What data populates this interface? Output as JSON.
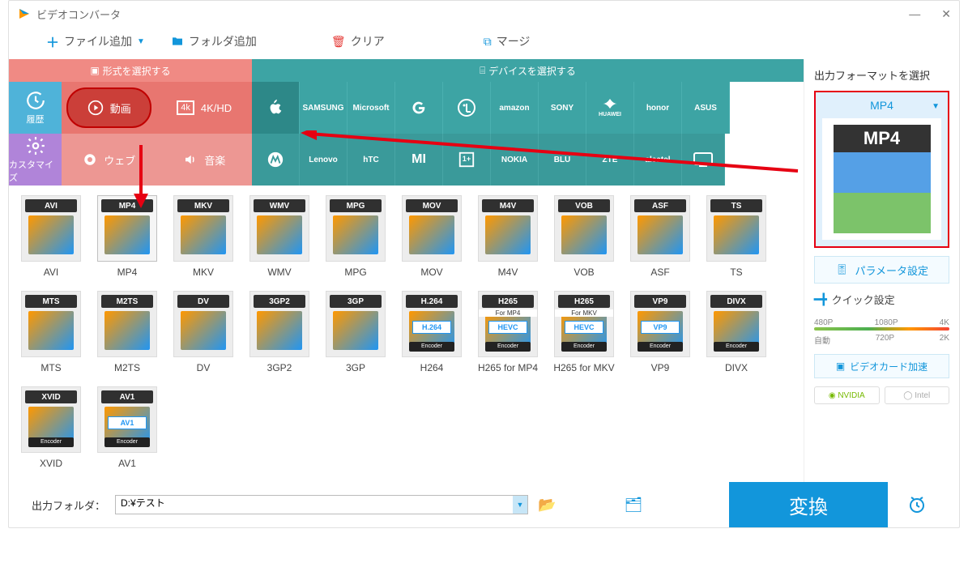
{
  "app": {
    "title": "ビデオコンバータ"
  },
  "toolbar": {
    "add_file": "ファイル追加",
    "add_folder": "フォルダ追加",
    "clear": "クリア",
    "merge": "マージ"
  },
  "selector_tabs": {
    "format": "形式を選択する",
    "device": "デバイスを選択する"
  },
  "left_nav": {
    "history": "履歴",
    "customize": "カスタマイズ"
  },
  "categories": {
    "video": "動画",
    "hd": "4K/HD",
    "web": "ウェブ",
    "audio": "音楽"
  },
  "brands_row1": [
    "Apple",
    "SAMSUNG",
    "Microsoft",
    "G",
    "LG",
    "amazon",
    "SONY",
    "HUAWEI",
    "honor",
    "ASUS"
  ],
  "brands_row2": [
    "moto",
    "Lenovo",
    "hTC",
    "MI",
    "OnePlus",
    "NOKIA",
    "BLU",
    "ZTE",
    "alcatel",
    "TV"
  ],
  "formats": [
    {
      "code": "AVI",
      "label": "AVI"
    },
    {
      "code": "MP4",
      "label": "MP4",
      "selected": true
    },
    {
      "code": "MKV",
      "label": "MKV"
    },
    {
      "code": "WMV",
      "label": "WMV"
    },
    {
      "code": "MPG",
      "label": "MPG"
    },
    {
      "code": "MOV",
      "label": "MOV"
    },
    {
      "code": "M4V",
      "label": "M4V"
    },
    {
      "code": "VOB",
      "label": "VOB"
    },
    {
      "code": "ASF",
      "label": "ASF"
    },
    {
      "code": "TS",
      "label": "TS"
    },
    {
      "code": "MTS",
      "label": "MTS"
    },
    {
      "code": "M2TS",
      "label": "M2TS"
    },
    {
      "code": "DV",
      "label": "DV"
    },
    {
      "code": "3GP2",
      "label": "3GP2"
    },
    {
      "code": "3GP",
      "label": "3GP"
    },
    {
      "code": "H.264",
      "label": "H264",
      "encoder": "Encoder",
      "sub": "H.264"
    },
    {
      "code": "H265",
      "label": "H265 for MP4",
      "encoder": "Encoder",
      "sub": "HEVC",
      "note": "For MP4"
    },
    {
      "code": "H265",
      "label": "H265 for MKV",
      "encoder": "Encoder",
      "sub": "HEVC",
      "note": "For MKV"
    },
    {
      "code": "VP9",
      "label": "VP9",
      "encoder": "Encoder",
      "sub": "VP9"
    },
    {
      "code": "DIVX",
      "label": "DIVX",
      "encoder": "Encoder"
    },
    {
      "code": "XVID",
      "label": "XVID",
      "encoder": "Encoder"
    },
    {
      "code": "AV1",
      "label": "AV1",
      "encoder": "Encoder",
      "sub": "AV1"
    }
  ],
  "sidebar": {
    "title": "出力フォーマットを選択",
    "preview_format": "MP4",
    "param_settings": "パラメータ設定",
    "quick_settings": "クイック設定",
    "resolutions_top": [
      "480P",
      "1080P",
      "4K"
    ],
    "resolutions_bottom": [
      "自動",
      "720P",
      "2K"
    ],
    "gpu_accel": "ビデオカード加速",
    "nvidia": "NVIDIA",
    "intel": "Intel"
  },
  "bottom": {
    "output_folder_label": "出力フォルダ：",
    "output_folder_value": "D:¥テスト",
    "convert": "変換"
  }
}
